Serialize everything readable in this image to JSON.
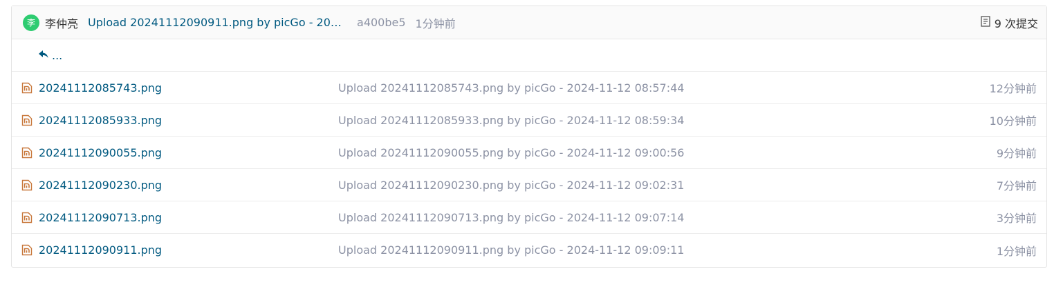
{
  "header": {
    "avatar_char": "李",
    "author": "李仲亮",
    "commit_message": "Upload 20241112090911.png by picGo - 2024-...",
    "sha": "a400be5",
    "time": "1分钟前",
    "commits_label": "9 次提交"
  },
  "back_row": {
    "label": "..."
  },
  "files": [
    {
      "name": "20241112085743.png",
      "message": "Upload 20241112085743.png by picGo - 2024-11-12 08:57:44",
      "time": "12分钟前"
    },
    {
      "name": "20241112085933.png",
      "message": "Upload 20241112085933.png by picGo - 2024-11-12 08:59:34",
      "time": "10分钟前"
    },
    {
      "name": "20241112090055.png",
      "message": "Upload 20241112090055.png by picGo - 2024-11-12 09:00:56",
      "time": "9分钟前"
    },
    {
      "name": "20241112090230.png",
      "message": "Upload 20241112090230.png by picGo - 2024-11-12 09:02:31",
      "time": "7分钟前"
    },
    {
      "name": "20241112090713.png",
      "message": "Upload 20241112090713.png by picGo - 2024-11-12 09:07:14",
      "time": "3分钟前"
    },
    {
      "name": "20241112090911.png",
      "message": "Upload 20241112090911.png by picGo - 2024-11-12 09:09:11",
      "time": "1分钟前"
    }
  ],
  "colors": {
    "link": "#005980",
    "muted": "#8c92a4",
    "avatar_bg": "#2ecc71",
    "image_icon": "#c8773a"
  },
  "icons": {
    "avatar": "avatar",
    "commits": "commit-list-icon",
    "back": "reply-arrow-icon",
    "file": "image-file-icon"
  }
}
